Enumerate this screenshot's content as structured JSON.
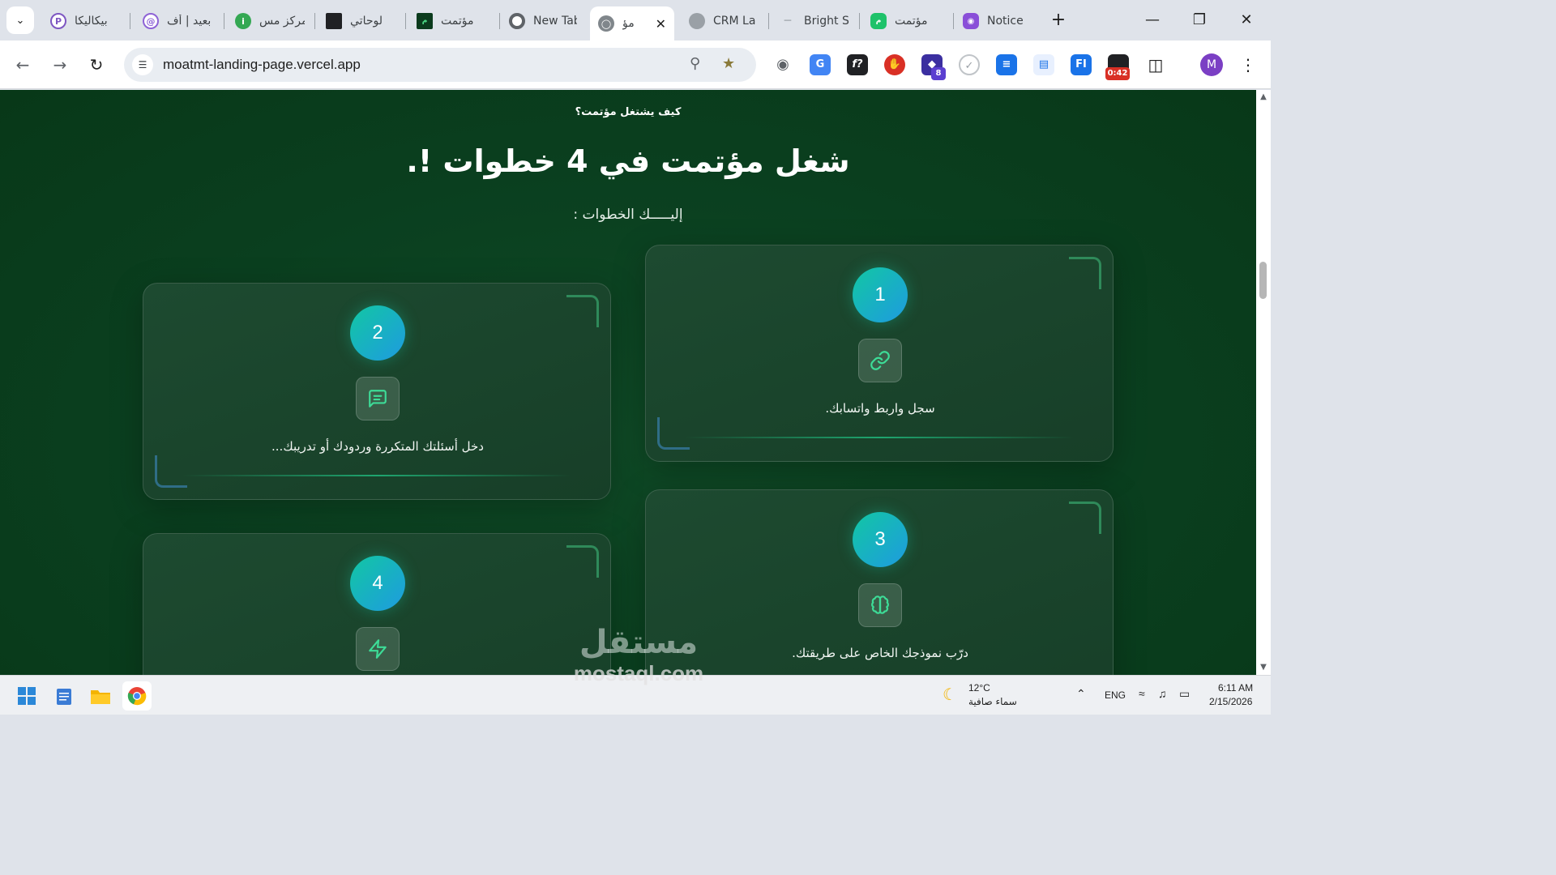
{
  "browser": {
    "tabs": [
      {
        "title": "بيكاليكا",
        "icon": "pikalika-icon",
        "color": "#7e57c2"
      },
      {
        "title": "بعيد | أف",
        "icon": "baeed-icon",
        "color": "#8e63d6"
      },
      {
        "title": "مركز مس",
        "icon": "info-leaf-icon",
        "color": "#34a853"
      },
      {
        "title": "لوحاتي",
        "icon": "boards-icon",
        "color": "#202124"
      },
      {
        "title": "مؤتمت",
        "icon": "moatmt-dark-icon",
        "color": "#0b3b1d"
      },
      {
        "title": "New Tab",
        "icon": "chrome-icon",
        "color": "#5f6368"
      },
      {
        "title": "مؤ",
        "icon": "globe-icon",
        "color": "#5f6368",
        "active": true
      },
      {
        "title": "CRM La",
        "icon": "globe-icon",
        "color": "#9aa0a6"
      },
      {
        "title": "Bright S",
        "icon": "key-icon",
        "color": "#9aa0a6"
      },
      {
        "title": "مؤتمت",
        "icon": "moatmt-green-icon",
        "color": "#1ec26a"
      },
      {
        "title": "Notice",
        "icon": "eye-icon",
        "color": "#8a4fd8"
      }
    ],
    "url": "moatmt-landing-page.vercel.app",
    "extensions": {
      "badge_count": "8",
      "timer": "0:42"
    },
    "avatar_letter": "M"
  },
  "page": {
    "eyebrow": "كيف يشتغل مؤتمت؟",
    "headline": "شغل مؤتمت في 4 خطوات !.",
    "subheading": "إليـــــك الخطوات :",
    "steps": [
      {
        "number": "1",
        "icon": "link-icon",
        "text": "سجل واربط واتسابك."
      },
      {
        "number": "2",
        "icon": "message-icon",
        "text": "دخل أسئلتك المتكررة وردودك أو تدريبك..."
      },
      {
        "number": "3",
        "icon": "brain-icon",
        "text": "درّب نموذجك الخاص على طريقتك."
      },
      {
        "number": "4",
        "icon": "bolt-icon",
        "text": ""
      }
    ],
    "accent": "#12c7a3",
    "background": "#0a3f1f"
  },
  "watermark": {
    "arabic": "مستقل",
    "latin": "mostaql.com"
  },
  "taskbar": {
    "weather_temp": "12°C",
    "weather_desc": "سماء صافية",
    "language": "ENG",
    "time": "6:11 AM",
    "date": "2/15/2026"
  }
}
